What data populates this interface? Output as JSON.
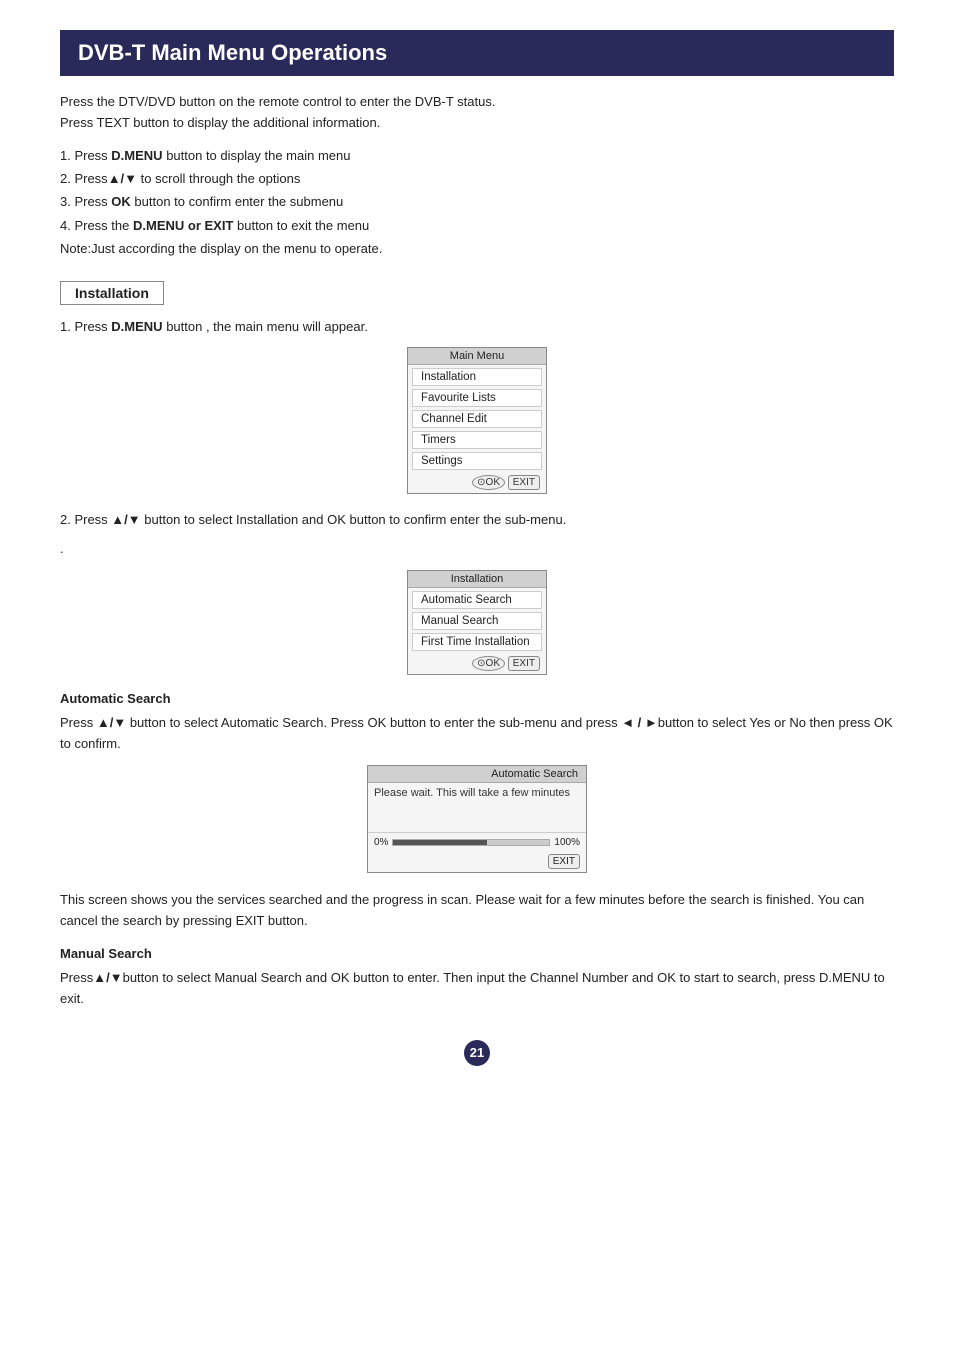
{
  "page": {
    "title": "DVB-T Main Menu Operations",
    "intro": [
      "Press the DTV/DVD button on the remote control to enter the DVB-T status.",
      "Press TEXT button to display the additional information."
    ],
    "steps": [
      "1. Press D.MENU button to display the main menu",
      "2. Press ▲/▼  to scroll through the options",
      "3. Press OK button to confirm enter the submenu",
      "4. Press the D.MENU or EXIT button to exit the menu",
      "Note:Just according the display on the menu to operate."
    ],
    "section_label": "Installation",
    "step1_text": "1. Press D.MENU button , the main menu will appear.",
    "main_menu": {
      "title": "Main Menu",
      "items": [
        "Installation",
        "Favourite Lists",
        "Channel Edit",
        "Timers",
        "Settings"
      ]
    },
    "step2_text": "2. Press ▲/▼  button to select Installation and OK button to confirm enter the sub-menu.",
    "install_menu": {
      "title": "Installation",
      "items": [
        "Automatic Search",
        "Manual Search",
        "First Time Installation"
      ]
    },
    "auto_search_section_title": "Automatic Search",
    "auto_search_desc": "Press ▲/▼  button to select Automatic Search. Press OK button to enter the sub-menu and press ◄ / ►button to select Yes or No then press OK to confirm.",
    "auto_search_box": {
      "title": "Automatic Search",
      "content": "Please wait. This will take a few minutes",
      "progress_start": "0%",
      "progress_end": "100%",
      "progress_fill_pct": 60
    },
    "auto_search_note": "This screen shows you the services searched and the progress in scan. Please wait for a few minutes before the search is finished. You can cancel the search by pressing EXIT button.",
    "manual_search_title": "Manual Search",
    "manual_search_desc": "Press▲/▼button to select Manual Search and OK button to enter. Then input the Channel Number and OK to start to search, press D.MENU to exit.",
    "page_number": "21"
  }
}
